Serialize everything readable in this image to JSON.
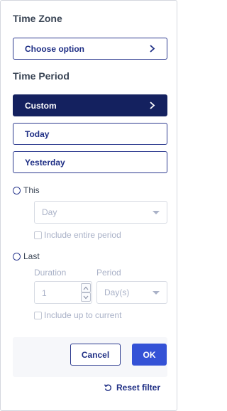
{
  "time_zone": {
    "title": "Time Zone",
    "choose_label": "Choose option"
  },
  "time_period": {
    "title": "Time Period",
    "options": [
      {
        "label": "Custom",
        "selected": true
      },
      {
        "label": "Today",
        "selected": false
      },
      {
        "label": "Yesterday",
        "selected": false
      }
    ]
  },
  "this": {
    "radio_label": "This",
    "unit_value": "Day",
    "include_label": "Include entire period"
  },
  "last": {
    "radio_label": "Last",
    "duration_label": "Duration",
    "duration_value": "1",
    "period_label": "Period",
    "period_value": "Day(s)",
    "include_label": "Include up to current"
  },
  "footer": {
    "cancel_label": "Cancel",
    "ok_label": "OK",
    "reset_label": "Reset filter"
  },
  "colors": {
    "navy": "#14215f",
    "accent_blue": "#3452d6",
    "border_navy": "#2c3a8f",
    "muted_text": "#a9b1c7"
  },
  "icons": {
    "chevron": "chevron-right-icon",
    "reset": "reset-icon"
  }
}
